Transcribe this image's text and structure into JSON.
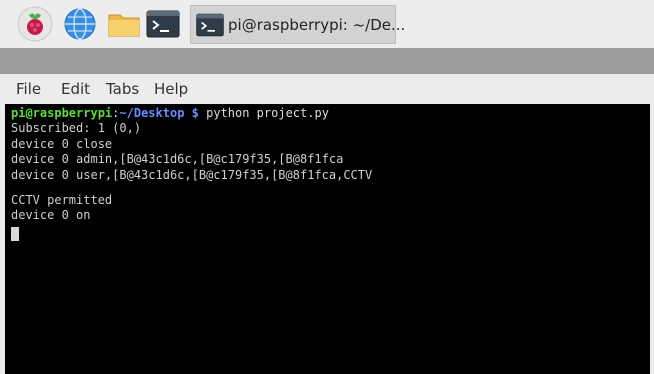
{
  "taskbar": {
    "launchers": [
      {
        "icon": "raspberry-menu-icon"
      },
      {
        "icon": "globe-browser-icon"
      },
      {
        "icon": "folder-icon"
      },
      {
        "icon": "terminal-icon"
      }
    ],
    "active_task": {
      "icon": "terminal-icon",
      "label": "pi@raspberrypi: ~/De..."
    }
  },
  "menu": {
    "file": "File",
    "edit": "Edit",
    "tabs": "Tabs",
    "help": "Help"
  },
  "terminal": {
    "prompt_user": "pi@raspberrypi",
    "prompt_sep": ":",
    "prompt_path": "~/Desktop $",
    "command": " python project.py",
    "lines": [
      "Subscribed: 1 (0,)",
      "device 0 close",
      "device 0 admin,[B@43c1d6c,[B@c179f35,[B@8f1fca",
      "device 0 user,[B@43c1d6c,[B@c179f35,[B@8f1fca,CCTV",
      "CCTV permitted",
      "device 0 on"
    ]
  },
  "colors": {
    "prompt_user": "#5ddc3a",
    "prompt_path": "#6b8cff",
    "terminal_bg": "#000000"
  }
}
